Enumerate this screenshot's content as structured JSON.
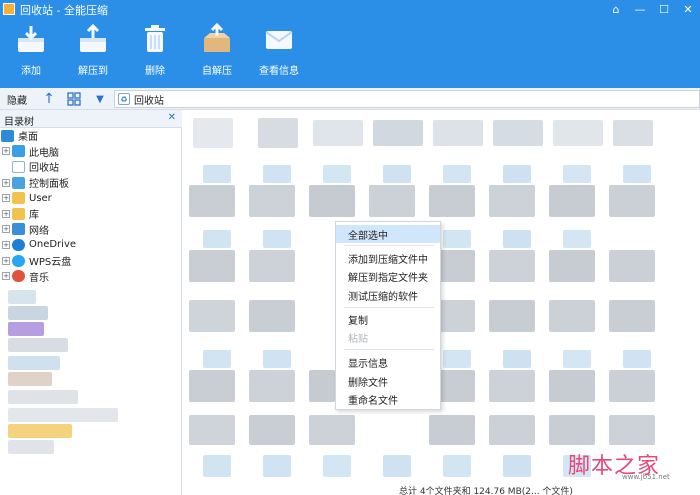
{
  "window": {
    "title": "回收站 - 全能压缩",
    "controls": [
      "restore-icon",
      "minimize-icon",
      "maximize-icon",
      "close-icon"
    ]
  },
  "toolbar": {
    "items": [
      {
        "label": "添加",
        "icon": "add-icon"
      },
      {
        "label": "解压到",
        "icon": "extract-to-icon"
      },
      {
        "label": "删除",
        "icon": "trash-icon"
      },
      {
        "label": "自解压",
        "icon": "self-extract-icon"
      },
      {
        "label": "查看信息",
        "icon": "info-mail-icon"
      }
    ]
  },
  "addressbar": {
    "hide_label": "隐藏",
    "path": "回收站"
  },
  "tree": {
    "title": "目录树",
    "items": [
      {
        "label": "桌面",
        "icon": "desktop-icon"
      },
      {
        "label": "此电脑",
        "icon": "computer-icon"
      },
      {
        "label": "回收站",
        "icon": "recycle-bin-icon"
      },
      {
        "label": "控制面板",
        "icon": "control-panel-icon"
      },
      {
        "label": "User",
        "icon": "folder-icon"
      },
      {
        "label": "库",
        "icon": "folder-icon"
      },
      {
        "label": "网络",
        "icon": "network-icon"
      },
      {
        "label": "OneDrive",
        "icon": "cloud-icon"
      },
      {
        "label": "WPS云盘",
        "icon": "cloud-icon"
      },
      {
        "label": "音乐",
        "icon": "music-icon"
      }
    ]
  },
  "context_menu": {
    "items": [
      {
        "label": "全部选中",
        "state": "highlighted"
      },
      {
        "label": "添加到压缩文件中",
        "state": "normal"
      },
      {
        "label": "解压到指定文件夹",
        "state": "normal"
      },
      {
        "label": "测试压缩的软件",
        "state": "normal"
      },
      {
        "label": "复制",
        "state": "normal"
      },
      {
        "label": "粘贴",
        "state": "disabled"
      },
      {
        "label": "显示信息",
        "state": "normal"
      },
      {
        "label": "删除文件",
        "state": "normal"
      },
      {
        "label": "重命名文件",
        "state": "normal"
      }
    ]
  },
  "status": {
    "text": "总计 4个文件夹和 124.76 MB(2... 个文件)"
  },
  "watermark": {
    "text": "脚本之家",
    "url": "www.jb51.net"
  },
  "colors": {
    "toolbar_bg": "#2b8fe8",
    "menu_highlight": "#cfe6fb",
    "watermark": "#e34a7a"
  }
}
